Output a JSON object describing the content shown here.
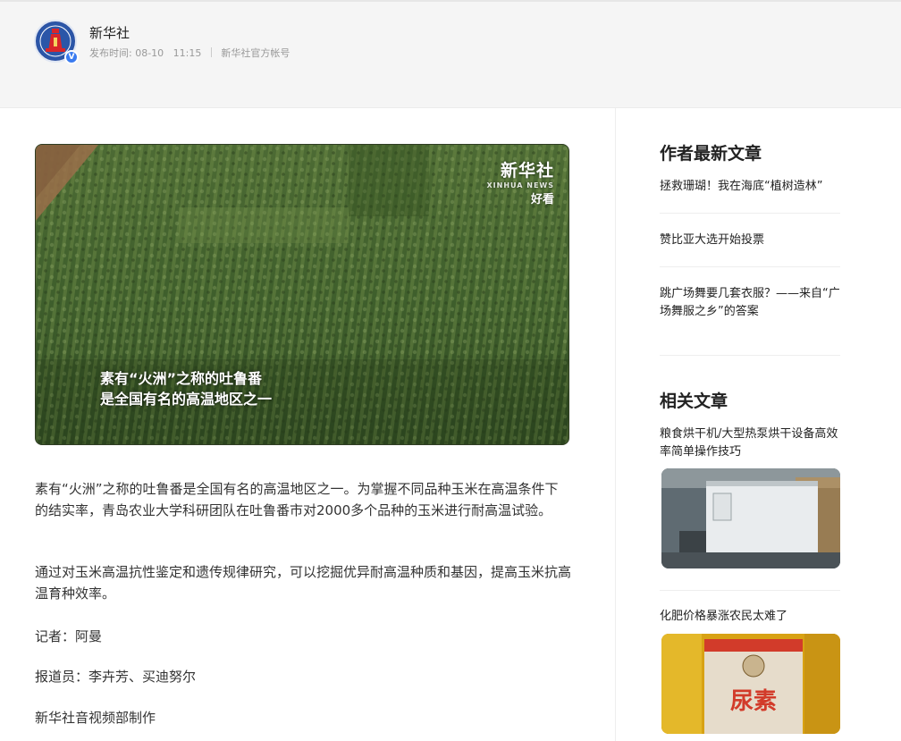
{
  "header": {
    "author_name": "新华社",
    "publish_label": "发布时间: 08-10",
    "publish_time": "11:15",
    "account_label": "新华社官方帐号",
    "verify_badge": "V"
  },
  "media": {
    "logo_main": "新华社",
    "logo_sub": "XINHUA NEWS",
    "logo_tag": "好看",
    "caption_line1": "素有“火洲”之称的吐鲁番",
    "caption_line2": "是全国有名的高温地区之一"
  },
  "article": {
    "p1": "素有“火洲”之称的吐鲁番是全国有名的高温地区之一。为掌握不同品种玉米在高温条件下的结实率，青岛农业大学科研团队在吐鲁番市对2000多个品种的玉米进行耐高温试验。",
    "p2": "通过对玉米高温抗性鉴定和遗传规律研究，可以挖掘优异耐高温种质和基因，提高玉米抗高温育种效率。",
    "p3": "记者：阿曼",
    "p4": "报道员：李卉芳、买迪努尔",
    "p5": "新华社音视频部制作"
  },
  "sidebar": {
    "latest_title": "作者最新文章",
    "latest": [
      "拯救珊瑚！我在海底“植树造林”",
      "赞比亚大选开始投票",
      "跳广场舞要几套衣服？——来自“广场舞服之乡”的答案"
    ],
    "related_title": "相关文章",
    "related": [
      "粮食烘干机/大型热泵烘干设备高效率简单操作技巧",
      "化肥价格暴涨农民太难了"
    ],
    "bag_text": "尿素"
  }
}
